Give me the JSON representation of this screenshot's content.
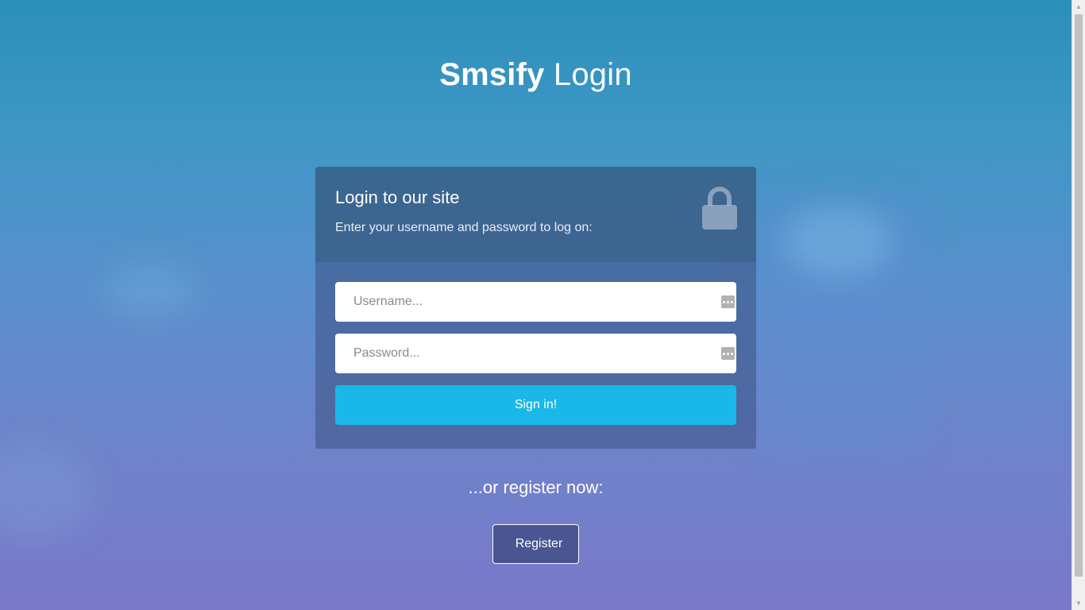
{
  "header": {
    "brand": "Smsify",
    "title_suffix": "Login"
  },
  "login_card": {
    "heading": "Login to our site",
    "subheading": "Enter your username and password to log on:",
    "icon": "lock-icon"
  },
  "form": {
    "username_placeholder": "Username...",
    "password_placeholder": "Password...",
    "field_icon": "password-manager-icon",
    "signin_label": "Sign in!"
  },
  "register": {
    "prompt": "...or register now:",
    "button_label": "Register"
  },
  "colors": {
    "signin_button": "#1ab8e8",
    "register_button": "#4a5591",
    "card_top": "#324b6e",
    "background_top": "#2b8fba",
    "background_bottom": "#7a78c9"
  }
}
